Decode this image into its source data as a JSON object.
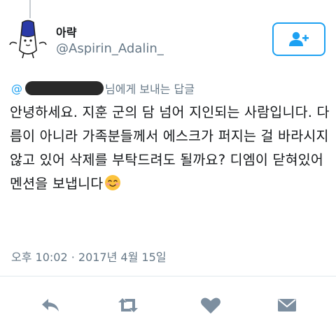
{
  "user": {
    "display_name": "아략",
    "handle": "@Aspirin_Adalin_"
  },
  "reply": {
    "at": "@",
    "suffix": "님에게 보내는 답글"
  },
  "tweet": {
    "text": "안녕하세요. 지훈 군의 담 넘어 지인되는 사람입니다. 다름이 아니라 가족분들께서 에스크가 퍼지는 걸 바라시지 않고 있어 삭제를 부탁드려도 될까요? 디엠이 닫혀있어 멘션을 보냅니다",
    "emoji": "smiling-face-emoji"
  },
  "meta": {
    "timestamp": "오후 10:02 · 2017년 4월 15일"
  },
  "icons": {
    "follow": "follow-user-icon",
    "reply": "reply-icon",
    "retweet": "retweet-icon",
    "like": "heart-icon",
    "message": "envelope-icon"
  },
  "colors": {
    "accent": "#1da1f2",
    "text": "#14171a",
    "secondary": "#657786",
    "icon": "#7d8fa0"
  }
}
